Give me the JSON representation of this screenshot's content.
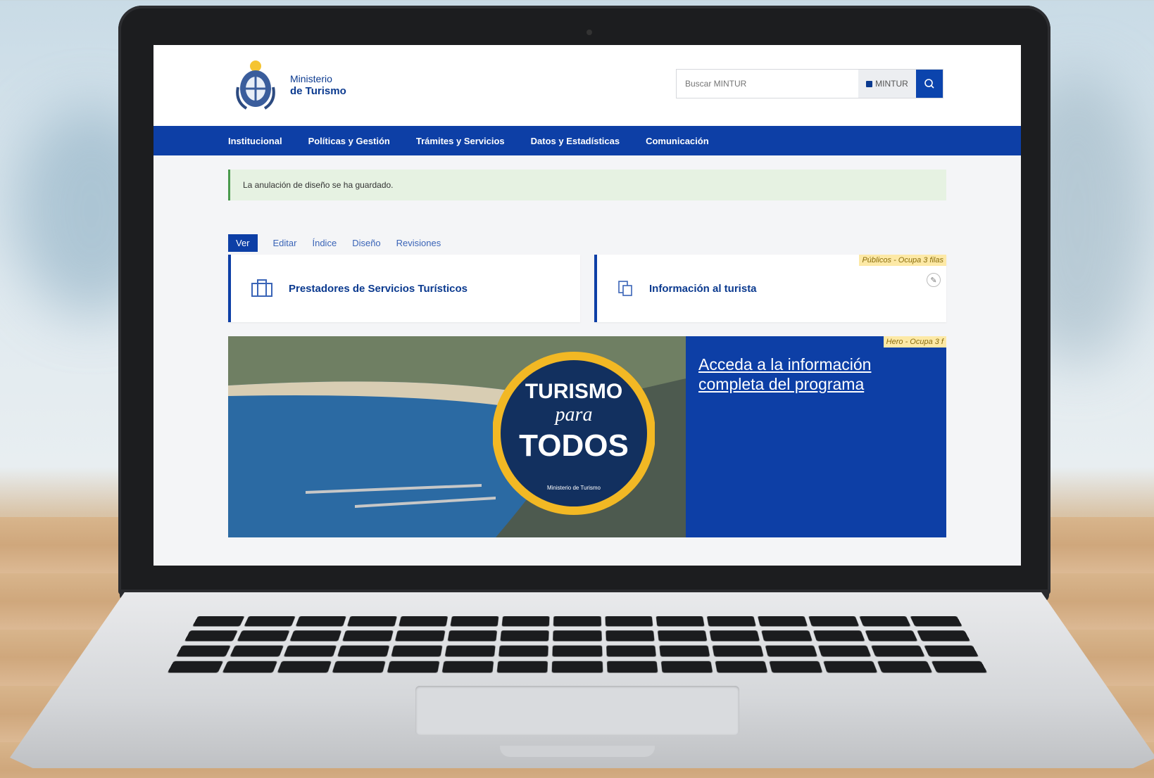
{
  "header": {
    "ministry_line1": "Ministerio",
    "ministry_line2": "de Turismo",
    "search_placeholder": "Buscar MINTUR",
    "search_scope": "MINTUR"
  },
  "nav": [
    "Institucional",
    "Políticas y Gestión",
    "Trámites y Servicios",
    "Datos y Estadísticas",
    "Comunicación"
  ],
  "alert": "La anulación de diseño se ha guardado.",
  "tabs": [
    "Ver",
    "Editar",
    "Índice",
    "Diseño",
    "Revisiones"
  ],
  "cards": [
    {
      "title": "Prestadores de Servicios Turísticos",
      "icon": "building-icon"
    },
    {
      "title": "Información al turista",
      "icon": "document-icon",
      "badge": "Públicos - Ocupa 3 filas"
    }
  ],
  "hero": {
    "badge": "Hero - Ocupa 3 f",
    "link": "Acceda a la información completa del programa",
    "logo_top": "TURISMO",
    "logo_mid": "para",
    "logo_main": "TODOS",
    "logo_sub": "Ministerio de Turismo"
  },
  "colors": {
    "primary": "#0d3fa6",
    "alert_bg": "#e6f2e2",
    "badge_bg": "#fde9a6",
    "logo_ring": "#f2b824"
  }
}
